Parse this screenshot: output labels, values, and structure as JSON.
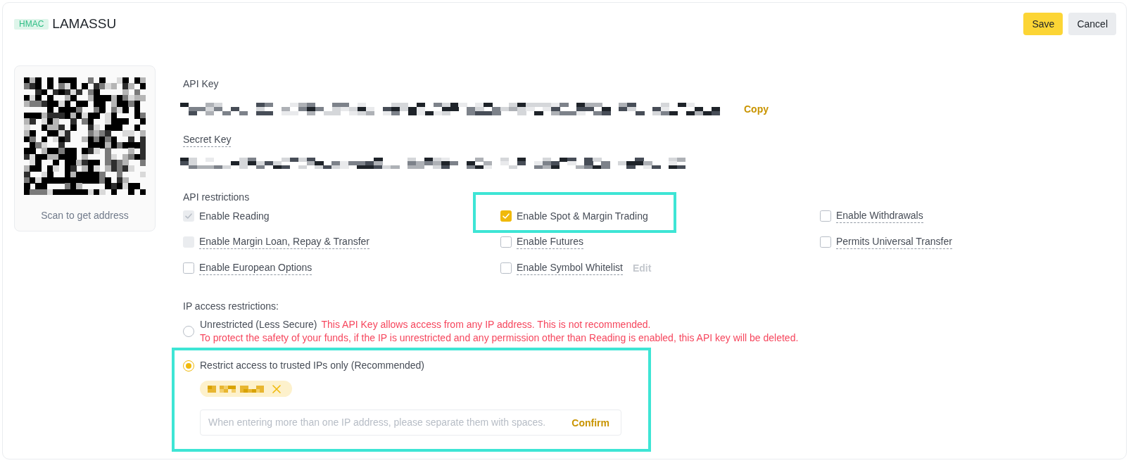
{
  "header": {
    "badge": "HMAC",
    "title": "LAMASSU",
    "buttons": [
      {
        "label": "Save",
        "kind": "primary"
      },
      {
        "label": "Cancel",
        "kind": "secondary"
      }
    ]
  },
  "qr_panel": {
    "caption": "Scan to get address"
  },
  "api_key": {
    "label": "API Key",
    "has_tooltip": false,
    "value": {
      "kind": "pixelated"
    },
    "copy_button": "Copy"
  },
  "secret_key": {
    "label": "Secret Key",
    "has_tooltip": true,
    "value": {
      "kind": "pixelated"
    }
  },
  "api_restrictions": {
    "title": "API restrictions",
    "permissions": [
      {
        "label": "Enable Reading",
        "checked": true,
        "disabled": true,
        "has_tooltip": false,
        "highlighted": false
      },
      {
        "label": "Enable Spot & Margin Trading",
        "checked": true,
        "disabled": false,
        "has_tooltip": false,
        "highlighted": true
      },
      {
        "label": "Enable Withdrawals",
        "checked": false,
        "disabled": false,
        "has_tooltip": true,
        "highlighted": false
      },
      {
        "label": "Enable Margin Loan, Repay & Transfer",
        "checked": false,
        "disabled": true,
        "has_tooltip": true,
        "highlighted": false
      },
      {
        "label": "Enable Futures",
        "checked": false,
        "disabled": false,
        "has_tooltip": true,
        "highlighted": false
      },
      {
        "label": "Permits Universal Transfer",
        "checked": false,
        "disabled": false,
        "has_tooltip": true,
        "highlighted": false
      },
      {
        "label": "Enable European Options",
        "checked": false,
        "disabled": false,
        "has_tooltip": true,
        "highlighted": false
      },
      {
        "label": "Enable Symbol Whitelist",
        "checked": false,
        "disabled": false,
        "has_tooltip": true,
        "highlighted": false,
        "action": {
          "label": "Edit",
          "disabled": true
        }
      }
    ]
  },
  "ip_access": {
    "title": "IP access restrictions:",
    "options": [
      {
        "label": "Unrestricted (Less Secure)",
        "selected": false,
        "highlighted": false,
        "warnings": [
          "This API Key allows access from any IP address. This is not recommended.",
          "To protect the safety of your funds, if the IP is unrestricted and any permission other than Reading is enabled, this API key will be deleted."
        ]
      },
      {
        "label": "Restrict access to trusted IPs only (Recommended)",
        "selected": true,
        "highlighted": true,
        "ip_tags": [
          {
            "kind": "pixelated"
          }
        ],
        "ip_input": {
          "placeholder": "When entering more than one IP address, please separate them with spaces.",
          "button": "Confirm"
        }
      }
    ]
  }
}
